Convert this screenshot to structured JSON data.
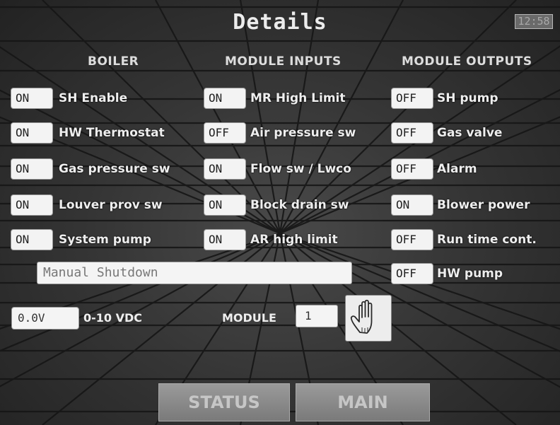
{
  "title": "Details",
  "clock": "12:58",
  "headers": {
    "boiler": "BOILER",
    "inputs": "MODULE INPUTS",
    "outputs": "MODULE OUTPUTS"
  },
  "boiler": [
    {
      "state": "ON",
      "label": "SH Enable"
    },
    {
      "state": "ON",
      "label": "HW Thermostat"
    },
    {
      "state": "ON",
      "label": "Gas pressure sw"
    },
    {
      "state": "ON",
      "label": "Louver prov sw"
    },
    {
      "state": "ON",
      "label": "System pump"
    }
  ],
  "inputs": [
    {
      "state": "ON",
      "label": "MR High Limit"
    },
    {
      "state": "OFF",
      "label": "Air pressure sw"
    },
    {
      "state": "ON",
      "label": "Flow sw / Lwco"
    },
    {
      "state": "ON",
      "label": "Block drain sw"
    },
    {
      "state": "ON",
      "label": "AR high limit"
    }
  ],
  "outputs": [
    {
      "state": "OFF",
      "label": "SH pump"
    },
    {
      "state": "OFF",
      "label": "Gas valve"
    },
    {
      "state": "OFF",
      "label": "Alarm"
    },
    {
      "state": "ON",
      "label": "Blower power"
    },
    {
      "state": "OFF",
      "label": "Run time cont."
    },
    {
      "state": "OFF",
      "label": "HW pump"
    }
  ],
  "status_message": "Manual Shutdown",
  "voltage": {
    "value": "0.0V",
    "label": "0-10 VDC"
  },
  "module": {
    "label": "MODULE",
    "value": "1"
  },
  "icons": {
    "manual": "hand-icon"
  },
  "nav": {
    "status": "STATUS",
    "main": "MAIN"
  }
}
